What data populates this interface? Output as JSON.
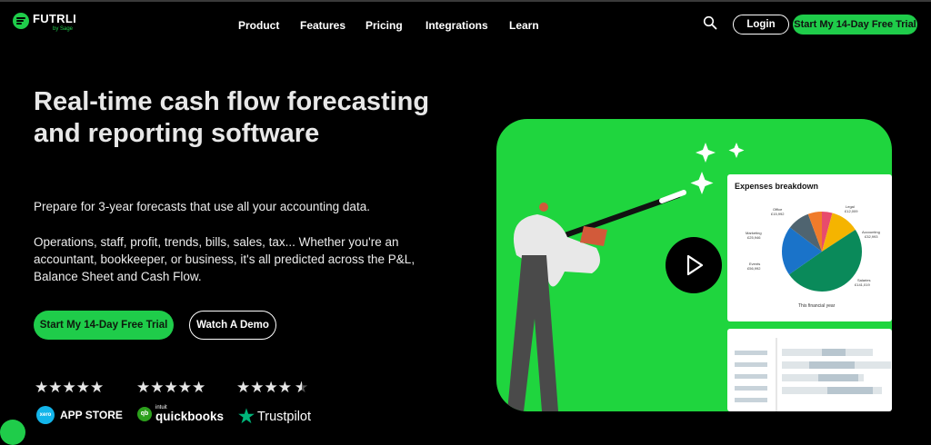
{
  "header": {
    "logo_text": "FUTRLI",
    "logo_sub": "by Sage",
    "nav": [
      "Product",
      "Features",
      "Pricing",
      "Integrations",
      "Learn"
    ],
    "login_label": "Login",
    "trial_label": "Start My 14-Day Free Trial"
  },
  "hero": {
    "title": "Real-time cash flow forecasting and reporting software",
    "paragraph1": "Prepare for 3-year forecasts that use all your accounting data.",
    "paragraph2": "Operations, staff, profit, trends, bills, sales, tax... Whether you're an accountant, bookkeeper, or business, it's all predicted across the P&L, Balance Sheet and Cash Flow.",
    "cta_label": "Start My 14-Day Free Trial",
    "demo_label": "Watch A Demo"
  },
  "ratings": [
    {
      "stars": 5,
      "label": "APP STORE",
      "badge": "xero"
    },
    {
      "stars": 5,
      "label": "quickbooks",
      "badge_sub": "intuit",
      "badge": "qb"
    },
    {
      "stars": 4.5,
      "label": "Trustpilot",
      "badge": "trustpilot"
    }
  ],
  "video_card": {
    "chart_title": "Expenses breakdown",
    "caption": "This financial year",
    "chart_data": {
      "type": "pie",
      "slices": [
        {
          "name": "Legal",
          "value_label": "£12,009",
          "color": "#e84b6c"
        },
        {
          "name": "Accounting",
          "value_label": "£32,993",
          "color": "#f5b400"
        },
        {
          "name": "Salaries",
          "value_label": "£141,019",
          "color": "#0a8a5a"
        },
        {
          "name": "Events",
          "value_label": "£56,992",
          "color": "#1a73c9"
        },
        {
          "name": "Marketing",
          "value_label": "£25,946",
          "color": "#4f6470"
        },
        {
          "name": "Office",
          "value_label": "£15,992",
          "color": "#f07b2a"
        }
      ]
    }
  },
  "colors": {
    "accent": "#1fcc4a",
    "panel": "#1fd53e",
    "background": "#000000"
  }
}
